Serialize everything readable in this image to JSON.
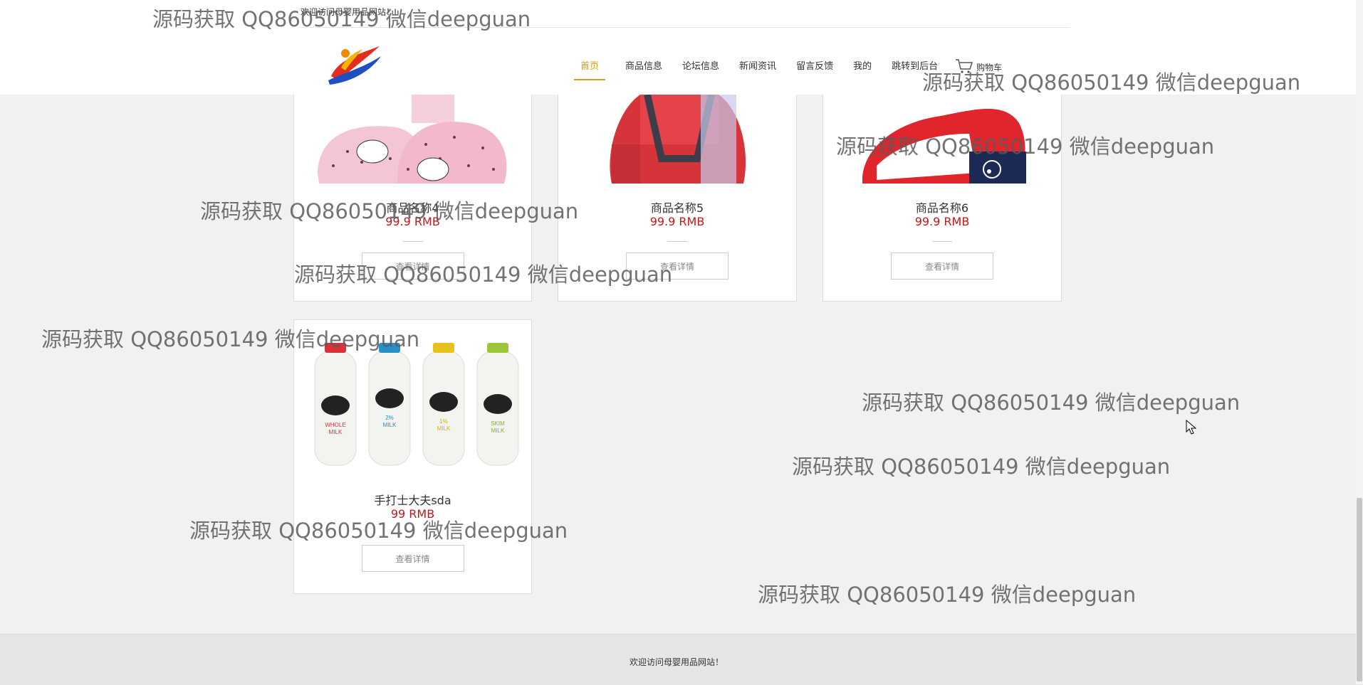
{
  "header": {
    "welcome": "欢迎访问母婴用品网站！",
    "nav": [
      "首页",
      "商品信息",
      "论坛信息",
      "新闻资讯",
      "留言反馈",
      "我的",
      "跳转到后台"
    ],
    "cart_label": "购物车"
  },
  "products": [
    {
      "name": "商品名称4",
      "price": "99.9 RMB",
      "button": "查看详情",
      "image": "pink-kitty-baby-shoes"
    },
    {
      "name": "商品名称5",
      "price": "99.9 RMB",
      "button": "查看详情",
      "image": "red-child-car-seat"
    },
    {
      "name": "商品名称6",
      "price": "99.9 RMB",
      "button": "查看详情",
      "image": "red-white-baby-sneakers"
    },
    {
      "name": "手打士大夫sda",
      "price": "99 RMB",
      "button": "查看详情",
      "image": "milk-bottles"
    }
  ],
  "footer": {
    "text": "欢迎访问母婴用品网站！"
  },
  "watermark": "源码获取 QQ86050149 微信deepguan",
  "colors": {
    "accent": "#d4a017",
    "price": "#c8161d",
    "page_bg": "#f1f1f1"
  }
}
